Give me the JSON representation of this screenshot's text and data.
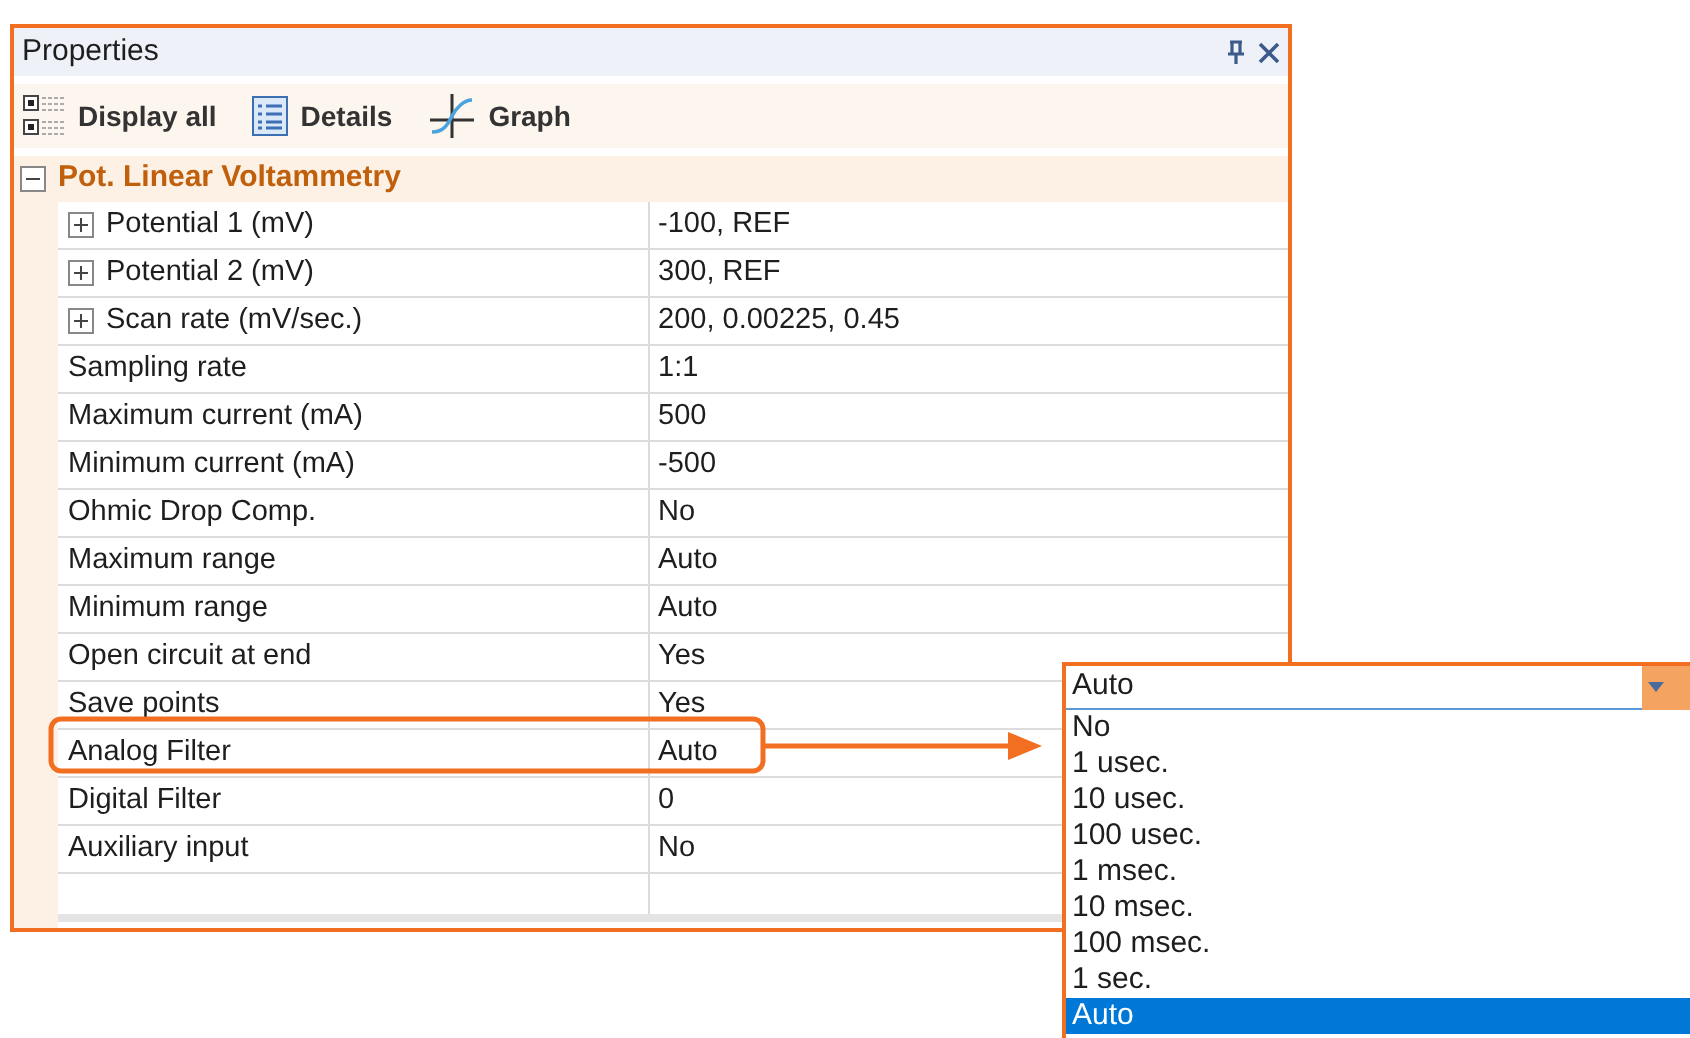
{
  "panel": {
    "title": "Properties"
  },
  "toolbar": [
    {
      "kind": "list",
      "label": "Display all"
    },
    {
      "kind": "details",
      "label": "Details"
    },
    {
      "kind": "graph",
      "label": "Graph"
    }
  ],
  "group": {
    "label": "Pot. Linear Voltammetry",
    "expanded": true,
    "rows": [
      {
        "name": "Potential 1 (mV)",
        "value": "-100, REF",
        "expandable": true
      },
      {
        "name": "Potential 2 (mV)",
        "value": "300, REF",
        "expandable": true
      },
      {
        "name": "Scan rate (mV/sec.)",
        "value": "200, 0.00225, 0.45",
        "expandable": true
      },
      {
        "name": "Sampling rate",
        "value": "1:1",
        "expandable": false
      },
      {
        "name": "Maximum current (mA)",
        "value": "500",
        "expandable": false
      },
      {
        "name": "Minimum current (mA)",
        "value": "-500",
        "expandable": false
      },
      {
        "name": "Ohmic Drop Comp.",
        "value": "No",
        "expandable": false
      },
      {
        "name": "Maximum range",
        "value": "Auto",
        "expandable": false
      },
      {
        "name": "Minimum range",
        "value": "Auto",
        "expandable": false
      },
      {
        "name": "Open circuit at end",
        "value": "Yes",
        "expandable": false
      },
      {
        "name": "Save points",
        "value": "Yes",
        "expandable": false
      },
      {
        "name": "Analog Filter",
        "value": "Auto",
        "expandable": false,
        "highlighted": true
      },
      {
        "name": "Digital Filter",
        "value": "0",
        "expandable": false
      },
      {
        "name": "Auxiliary input",
        "value": "No",
        "expandable": false
      }
    ]
  },
  "dropdown": {
    "value": "Auto",
    "options": [
      {
        "label": "No",
        "selected": false
      },
      {
        "label": "1 usec.",
        "selected": false
      },
      {
        "label": "10 usec.",
        "selected": false
      },
      {
        "label": "100 usec.",
        "selected": false
      },
      {
        "label": "1 msec.",
        "selected": false
      },
      {
        "label": "10 msec.",
        "selected": false
      },
      {
        "label": "100 msec.",
        "selected": false
      },
      {
        "label": "1 sec.",
        "selected": false
      },
      {
        "label": "Auto",
        "selected": true
      }
    ]
  }
}
